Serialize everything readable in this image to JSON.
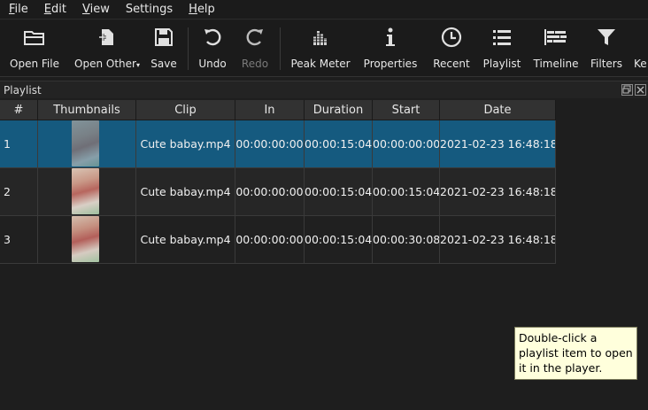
{
  "menu": [
    {
      "label": "File",
      "mnemonic": "F",
      "rest": "ile"
    },
    {
      "label": "Edit",
      "mnemonic": "E",
      "rest": "dit"
    },
    {
      "label": "View",
      "mnemonic": "V",
      "rest": "iew"
    },
    {
      "label": "Settings",
      "mnemonic": "S",
      "rest": "ettings"
    },
    {
      "label": "Help",
      "mnemonic": "H",
      "rest": "elp"
    }
  ],
  "toolbar": {
    "open_file": "Open File",
    "open_other": "Open Other",
    "save": "Save",
    "undo": "Undo",
    "redo": "Redo",
    "peak_meter": "Peak Meter",
    "properties": "Properties",
    "recent": "Recent",
    "playlist": "Playlist",
    "timeline": "Timeline",
    "filters": "Filters",
    "keyframes_partial": "Ke"
  },
  "dock": {
    "title": "Playlist"
  },
  "table": {
    "headers": [
      "#",
      "Thumbnails",
      "Clip",
      "In",
      "Duration",
      "Start",
      "Date"
    ],
    "rows": [
      {
        "num": "1",
        "clip": "Cute babay.mp4",
        "in": "00:00:00:00",
        "duration": "00:00:15:04",
        "start": "00:00:00:00",
        "date": "2021-02-23 16:48:18"
      },
      {
        "num": "2",
        "clip": "Cute babay.mp4",
        "in": "00:00:00:00",
        "duration": "00:00:15:04",
        "start": "00:00:15:04",
        "date": "2021-02-23 16:48:18"
      },
      {
        "num": "3",
        "clip": "Cute babay.mp4",
        "in": "00:00:00:00",
        "duration": "00:00:15:04",
        "start": "00:00:30:08",
        "date": "2021-02-23 16:48:18"
      }
    ]
  },
  "tooltip": "Double-click a playlist item to open it in the player.",
  "colors": {
    "selection": "#155a7f",
    "background": "#1e1e1e",
    "tooltip_bg": "#ffffdc"
  }
}
